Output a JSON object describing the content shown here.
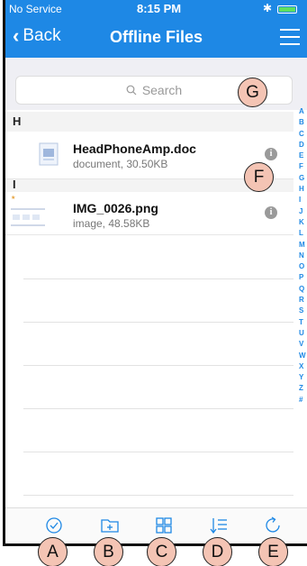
{
  "status_bar": {
    "carrier": "No Service",
    "time": "8:15 PM",
    "bluetooth_icon": "bluetooth-icon",
    "battery_icon": "battery-icon"
  },
  "nav": {
    "back_label": "Back",
    "title": "Offline Files",
    "menu_icon": "hamburger-menu-icon"
  },
  "search": {
    "placeholder": "Search",
    "icon": "magnifier-icon"
  },
  "sections": [
    {
      "header": "H",
      "files": [
        {
          "name": "HeadPhoneAmp.doc",
          "meta": "document, 30.50KB",
          "thumb_icon": "document-icon"
        }
      ]
    },
    {
      "header": "I",
      "files": [
        {
          "name": "IMG_0026.png",
          "meta": "image, 48.58KB",
          "thumb_icon": "image-thumbnail"
        }
      ]
    }
  ],
  "index_letters": [
    "A",
    "B",
    "C",
    "D",
    "E",
    "F",
    "G",
    "H",
    "I",
    "J",
    "K",
    "L",
    "M",
    "N",
    "O",
    "P",
    "Q",
    "R",
    "S",
    "T",
    "U",
    "V",
    "W",
    "X",
    "Y",
    "Z",
    "#"
  ],
  "toolbar": [
    {
      "icon": "select-check-icon"
    },
    {
      "icon": "new-folder-icon"
    },
    {
      "icon": "grid-view-icon"
    },
    {
      "icon": "sort-icon"
    },
    {
      "icon": "refresh-icon"
    }
  ],
  "markers": {
    "a": "A",
    "b": "B",
    "c": "C",
    "d": "D",
    "e": "E",
    "f": "F",
    "g": "G"
  },
  "colors": {
    "accent": "#1e88e5",
    "marker_fill": "#f4c4b4",
    "section_bg": "#f3f3f3"
  }
}
